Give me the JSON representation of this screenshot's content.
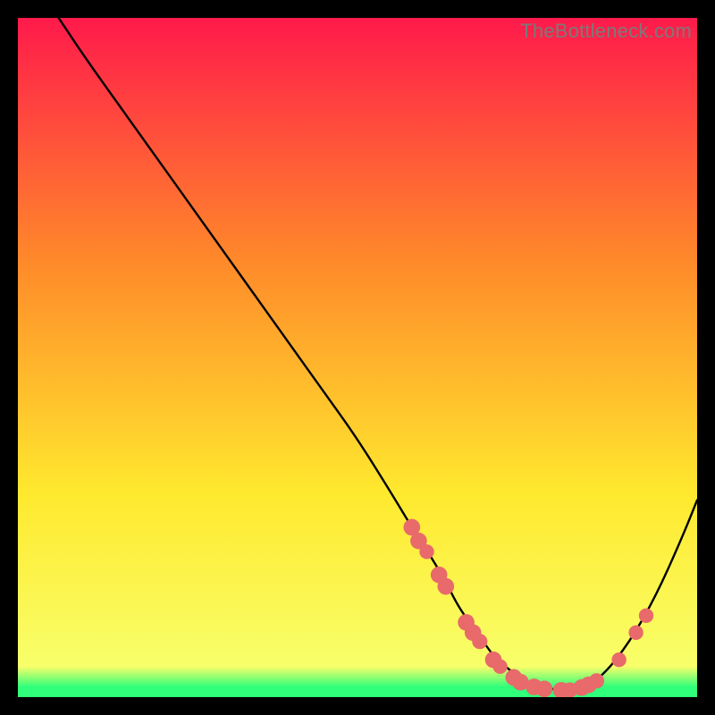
{
  "watermark": "TheBottleneck.com",
  "colors": {
    "gradient_top": "#ff1a4b",
    "gradient_mid1": "#ff8a2a",
    "gradient_mid2": "#ffe92e",
    "gradient_bottom_yellow": "#f8ff6a",
    "gradient_green": "#2fff7a",
    "curve": "#000000",
    "marker": "#e86a6a",
    "frame": "#000000"
  },
  "chart_data": {
    "type": "line",
    "title": "",
    "xlabel": "",
    "ylabel": "",
    "xlim": [
      0,
      100
    ],
    "ylim": [
      0,
      100
    ],
    "series": [
      {
        "name": "bottleneck-curve",
        "x": [
          6,
          10,
          15,
          20,
          25,
          30,
          35,
          40,
          45,
          50,
          55,
          58,
          60,
          63,
          65,
          68,
          70,
          73,
          75,
          78,
          80,
          83,
          86,
          90,
          94,
          98,
          100
        ],
        "y": [
          100,
          94,
          87,
          80,
          73,
          66,
          59,
          52,
          45,
          38,
          30,
          25,
          22,
          17,
          13,
          9,
          6,
          3.5,
          2.2,
          1.3,
          1.0,
          1.3,
          3,
          8,
          15,
          24,
          29
        ]
      }
    ],
    "markers": [
      {
        "x": 58,
        "y": 25,
        "r": 1.4
      },
      {
        "x": 59,
        "y": 23,
        "r": 1.4
      },
      {
        "x": 60.2,
        "y": 21.4,
        "r": 1.1
      },
      {
        "x": 62,
        "y": 18,
        "r": 1.4
      },
      {
        "x": 63,
        "y": 16.3,
        "r": 1.4
      },
      {
        "x": 66,
        "y": 11,
        "r": 1.4
      },
      {
        "x": 67,
        "y": 9.5,
        "r": 1.4
      },
      {
        "x": 68,
        "y": 8.2,
        "r": 1.2
      },
      {
        "x": 70,
        "y": 5.5,
        "r": 1.4
      },
      {
        "x": 71,
        "y": 4.5,
        "r": 1.1
      },
      {
        "x": 73,
        "y": 2.9,
        "r": 1.4
      },
      {
        "x": 74,
        "y": 2.2,
        "r": 1.4
      },
      {
        "x": 76,
        "y": 1.5,
        "r": 1.4
      },
      {
        "x": 77.5,
        "y": 1.2,
        "r": 1.4
      },
      {
        "x": 80,
        "y": 1.0,
        "r": 1.4
      },
      {
        "x": 81.3,
        "y": 1.05,
        "r": 1.2
      },
      {
        "x": 83,
        "y": 1.4,
        "r": 1.4
      },
      {
        "x": 84,
        "y": 1.8,
        "r": 1.4
      },
      {
        "x": 85.2,
        "y": 2.4,
        "r": 1.2
      },
      {
        "x": 88.5,
        "y": 5.5,
        "r": 1.1
      },
      {
        "x": 91,
        "y": 9.5,
        "r": 1.1
      },
      {
        "x": 92.5,
        "y": 12,
        "r": 1.1
      }
    ],
    "gradient_stops": [
      {
        "offset": 0.0,
        "key": "gradient_top"
      },
      {
        "offset": 0.36,
        "key": "gradient_mid1"
      },
      {
        "offset": 0.7,
        "key": "gradient_mid2"
      },
      {
        "offset": 0.955,
        "key": "gradient_bottom_yellow"
      },
      {
        "offset": 0.985,
        "key": "gradient_green"
      },
      {
        "offset": 1.0,
        "key": "gradient_green"
      }
    ]
  }
}
